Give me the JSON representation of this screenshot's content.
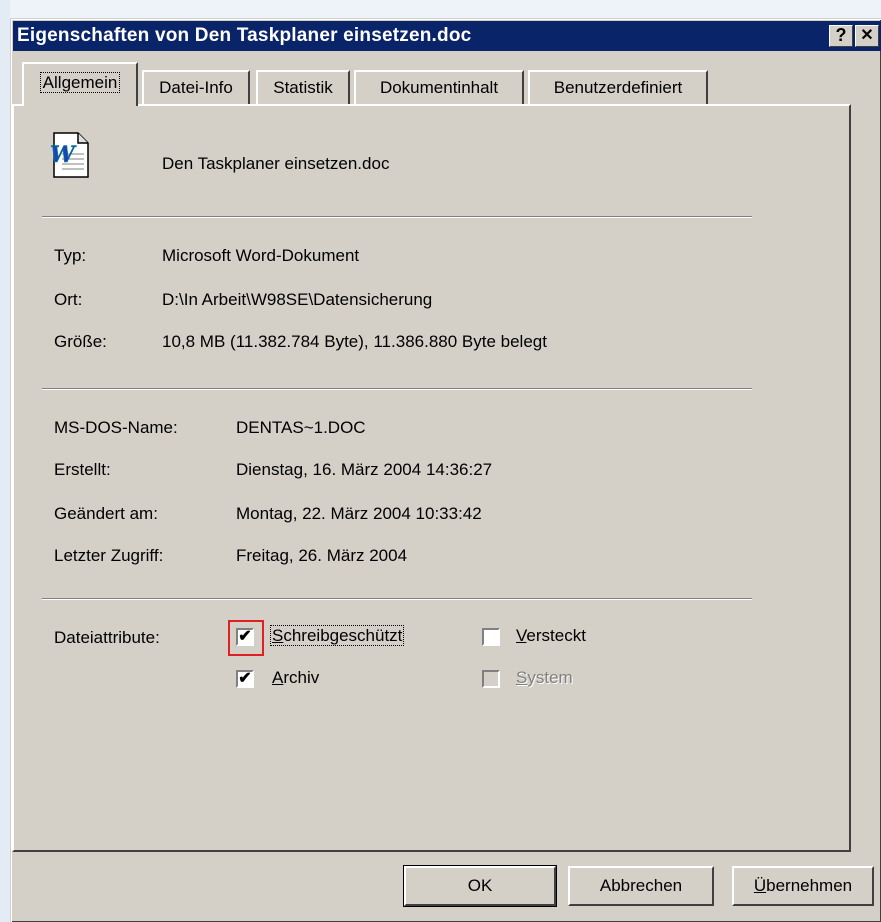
{
  "window": {
    "title": "Eigenschaften von Den Taskplaner einsetzen.doc",
    "help_label": "?",
    "close_label": "✕"
  },
  "tabs": [
    {
      "label": "Allgemein",
      "active": true
    },
    {
      "label": "Datei-Info",
      "active": false
    },
    {
      "label": "Statistik",
      "active": false
    },
    {
      "label": "Dokumentinhalt",
      "active": false
    },
    {
      "label": "Benutzerdefiniert",
      "active": false
    }
  ],
  "file": {
    "icon": "word-document-icon",
    "name": "Den Taskplaner einsetzen.doc"
  },
  "info": {
    "type_label": "Typ:",
    "type_value": "Microsoft Word-Dokument",
    "location_label": "Ort:",
    "location_value": "D:\\In Arbeit\\W98SE\\Datensicherung",
    "size_label": "Größe:",
    "size_value": "10,8 MB (11.382.784 Byte), 11.386.880 Byte belegt"
  },
  "dates": {
    "dosname_label": "MS-DOS-Name:",
    "dosname_value": "DENTAS~1.DOC",
    "created_label": "Erstellt:",
    "created_value": "Dienstag, 16. März 2004 14:36:27",
    "modified_label": "Geändert am:",
    "modified_value": "Montag, 22. März 2004 10:33:42",
    "accessed_label": "Letzter Zugriff:",
    "accessed_value": "Freitag, 26. März 2004"
  },
  "attributes": {
    "label": "Dateiattribute:",
    "readonly": {
      "label_prefix": "S",
      "label_rest": "chreibgeschützt",
      "checked": true
    },
    "hidden": {
      "label_prefix": "V",
      "label_rest": "ersteckt",
      "checked": false
    },
    "archive": {
      "label_prefix": "A",
      "label_rest": "rchiv",
      "checked": true
    },
    "system": {
      "label_prefix": "S",
      "label_rest": "ystem",
      "checked": false,
      "disabled": true
    },
    "check_mark": "✔",
    "highlight_color": "#e02020"
  },
  "buttons": {
    "ok": "OK",
    "cancel": "Abbrechen",
    "apply_prefix": "Ü",
    "apply_rest": "bernehmen"
  },
  "colors": {
    "titlebar": "#0a246a",
    "face": "#d4d0c8"
  }
}
